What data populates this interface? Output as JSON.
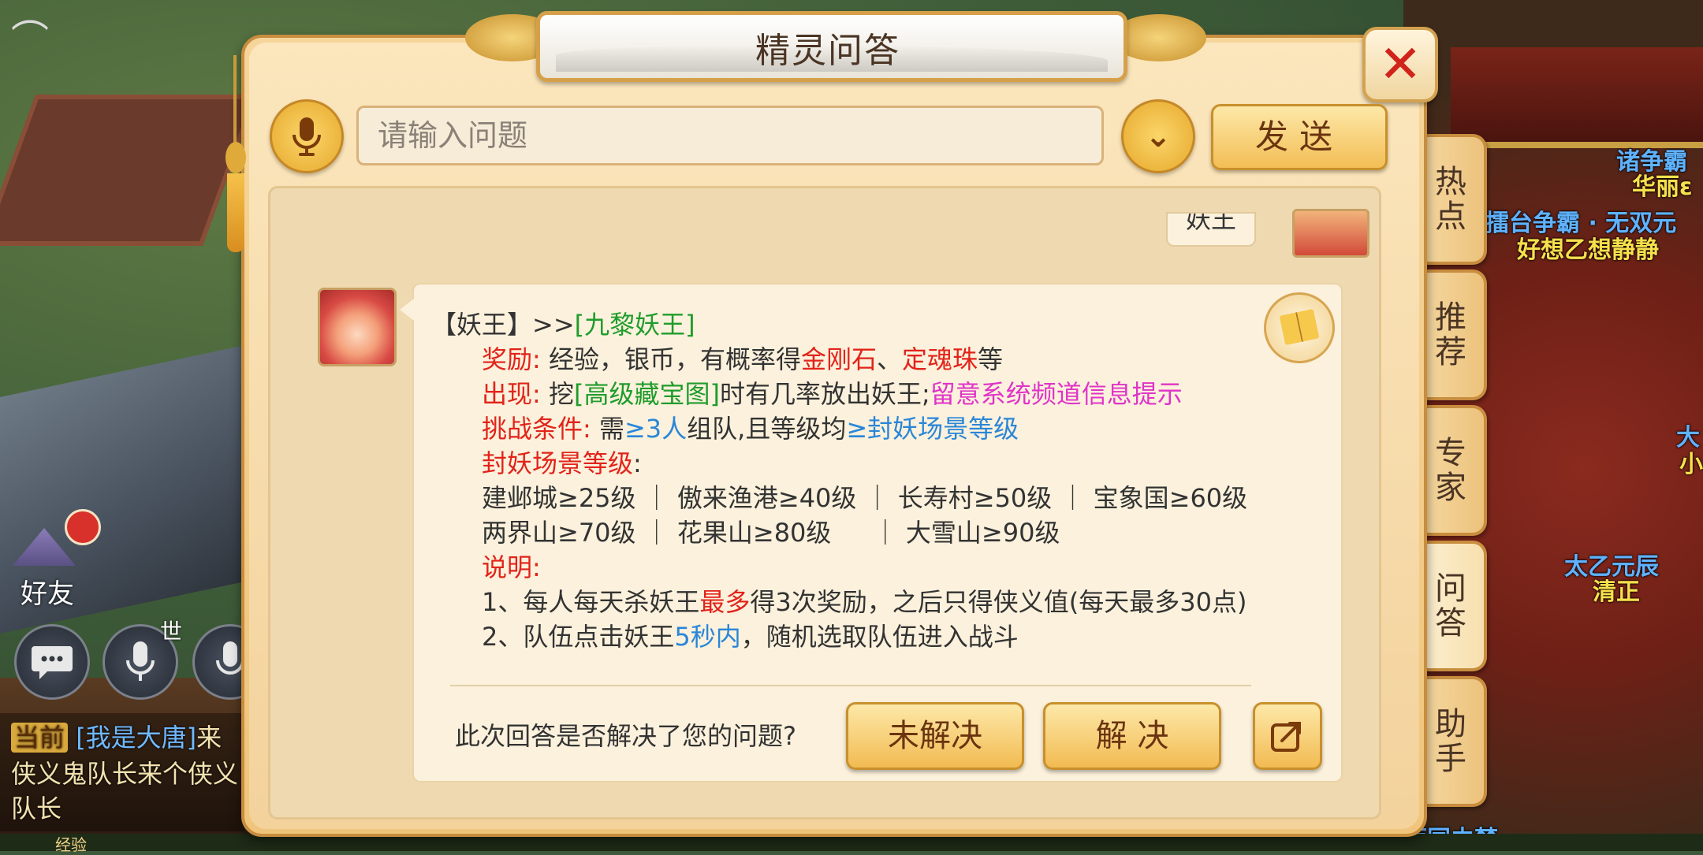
{
  "background": {
    "friend_label": "好友",
    "world_channel_label": "世",
    "chat": {
      "tag": "当前",
      "line1_name": "[我是大唐]",
      "line1_text": "来",
      "line2": "侠义鬼队长来个侠义",
      "line3": "队长"
    },
    "exp_label": "经验",
    "right_texts": {
      "t1": "诸争霸",
      "t2": "华丽ε",
      "t3": "擂台争霸 · 无双元",
      "t4": "好想乙想静静",
      "t5": "太乙元辰",
      "t6": "清正",
      "t7": "大",
      "t8": "小",
      "t9": "雨同由梦"
    }
  },
  "dialog": {
    "title": "精灵问答",
    "close_glyph": "✕",
    "input": {
      "value": "",
      "placeholder": "请输入问题"
    },
    "dropdown_glyph": "⌄",
    "send_label": "发送",
    "user_message": "妖王",
    "answer": {
      "line1_prefix": "【妖王】>>",
      "line1_link": "[九黎妖王]",
      "reward_label": "奖励:",
      "reward_text_1": "经验，银币，有概率得",
      "reward_item_1": "金刚石",
      "reward_sep": "、",
      "reward_item_2": "定魂珠",
      "reward_text_2": "等",
      "appear_label": "出现:",
      "appear_text_1": "挖",
      "appear_link": "[高级藏宝图]",
      "appear_text_2": "时有几率放出妖王;",
      "appear_hint": "留意系统频道信息提示",
      "challenge_label": "挑战条件:",
      "challenge_text_1": "需",
      "challenge_hl_1": "≥3人",
      "challenge_text_2": "组队,且等级均",
      "challenge_hl_2": "≥封妖场景等级",
      "scene_level_label": "封妖场景等级",
      "scene_level_colon": ":",
      "levels_row1": "建邺城≥25级 ｜ 傲来渔港≥40级 ｜ 长寿村≥50级 ｜ 宝象国≥60级",
      "levels_row2": "两界山≥70级 ｜ 花果山≥80级 　 ｜ 大雪山≥90级",
      "note_label": "说明:",
      "note1_a": "1、每人每天杀妖王",
      "note1_hl": "最多",
      "note1_b": "得3次奖励，之后只得侠义值(每天最多30点)",
      "note2_a": "2、队伍点击妖王",
      "note2_hl": "5秒内",
      "note2_b": "，随机选取队伍进入战斗"
    },
    "feedback": {
      "question": "此次回答是否解决了您的问题?",
      "unsolved_label": "未解决",
      "solved_label": "解 决"
    }
  },
  "side_tabs": [
    {
      "label": "热点"
    },
    {
      "label": "推荐"
    },
    {
      "label": "专家"
    },
    {
      "label": "问答"
    },
    {
      "label": "助手"
    }
  ],
  "colors": {
    "reward_red": "#e2231a",
    "link_green": "#1f9c2c",
    "highlight_blue": "#2a86d8",
    "hint_pink": "#e034c8",
    "panel_gold": "#f0c57b"
  }
}
